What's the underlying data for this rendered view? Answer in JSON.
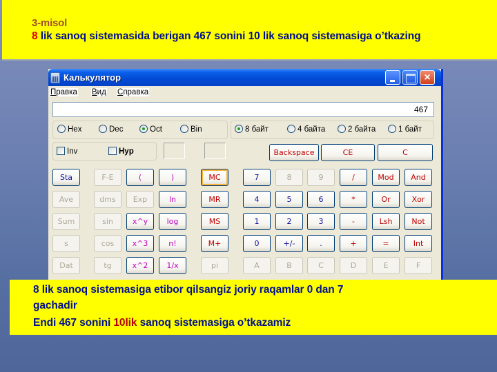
{
  "slide": {
    "top_banner": {
      "heading": "3-misol",
      "task_prefix": "8",
      "task_text": " lik sanoq sistemasida berigan 467 sonini 10 lik sanoq sistemasiga o’tkazing"
    },
    "bottom_banner": {
      "line1": "8 lik sanoq sistemasiga etibor qilsangiz joriy raqamlar 0 dan 7",
      "line2": "gachadir",
      "line3_prefix": "Endi 467 sonini ",
      "line3_highlight": "10lik",
      "line3_suffix": " sanoq sistemasiga o’tkazamiz"
    }
  },
  "window": {
    "title": "Калькулятор",
    "icon": "calculator-icon",
    "controls": {
      "minimize": "minimize-icon",
      "maximize": "maximize-icon",
      "close": "×"
    },
    "menu": [
      {
        "accel": "П",
        "rest": "равка"
      },
      {
        "accel": "В",
        "rest": "ид"
      },
      {
        "accel": "С",
        "rest": "правка"
      }
    ],
    "display_value": "467",
    "base_options": [
      {
        "label": "Hex",
        "selected": false
      },
      {
        "label": "Dec",
        "selected": false
      },
      {
        "label": "Oct",
        "selected": true
      },
      {
        "label": "Bin",
        "selected": false
      }
    ],
    "word_options": [
      {
        "label": "8 байт",
        "selected": true
      },
      {
        "label": "4 байта",
        "selected": false
      },
      {
        "label": "2 байта",
        "selected": false
      },
      {
        "label": "1 байт",
        "selected": false
      }
    ],
    "checkboxes": [
      {
        "label": "Inv",
        "checked": false
      },
      {
        "label": "Hyp",
        "checked": false
      }
    ],
    "edit_buttons": [
      "Backspace",
      "CE",
      "C"
    ],
    "stat_buttons": [
      "Sta",
      "Ave",
      "Sum",
      "s",
      "Dat"
    ],
    "sci_col1": [
      "F-E",
      "dms",
      "sin",
      "cos",
      "tg"
    ],
    "sci_col2": [
      "(",
      "Exp",
      "x^y",
      "x^3",
      "x^2"
    ],
    "sci_col3": [
      ")",
      "ln",
      "log",
      "n!",
      "1/x"
    ],
    "mem_buttons": [
      "MC",
      "MR",
      "MS",
      "M+",
      "pi"
    ],
    "keypad": [
      [
        "7",
        "8",
        "9",
        "/",
        "Mod",
        "And"
      ],
      [
        "4",
        "5",
        "6",
        "*",
        "Or",
        "Xor"
      ],
      [
        "1",
        "2",
        "3",
        "-",
        "Lsh",
        "Not"
      ],
      [
        "0",
        "+/-",
        ".",
        "+",
        "=",
        "Int"
      ],
      [
        "A",
        "B",
        "C",
        "D",
        "E",
        "F"
      ]
    ]
  }
}
